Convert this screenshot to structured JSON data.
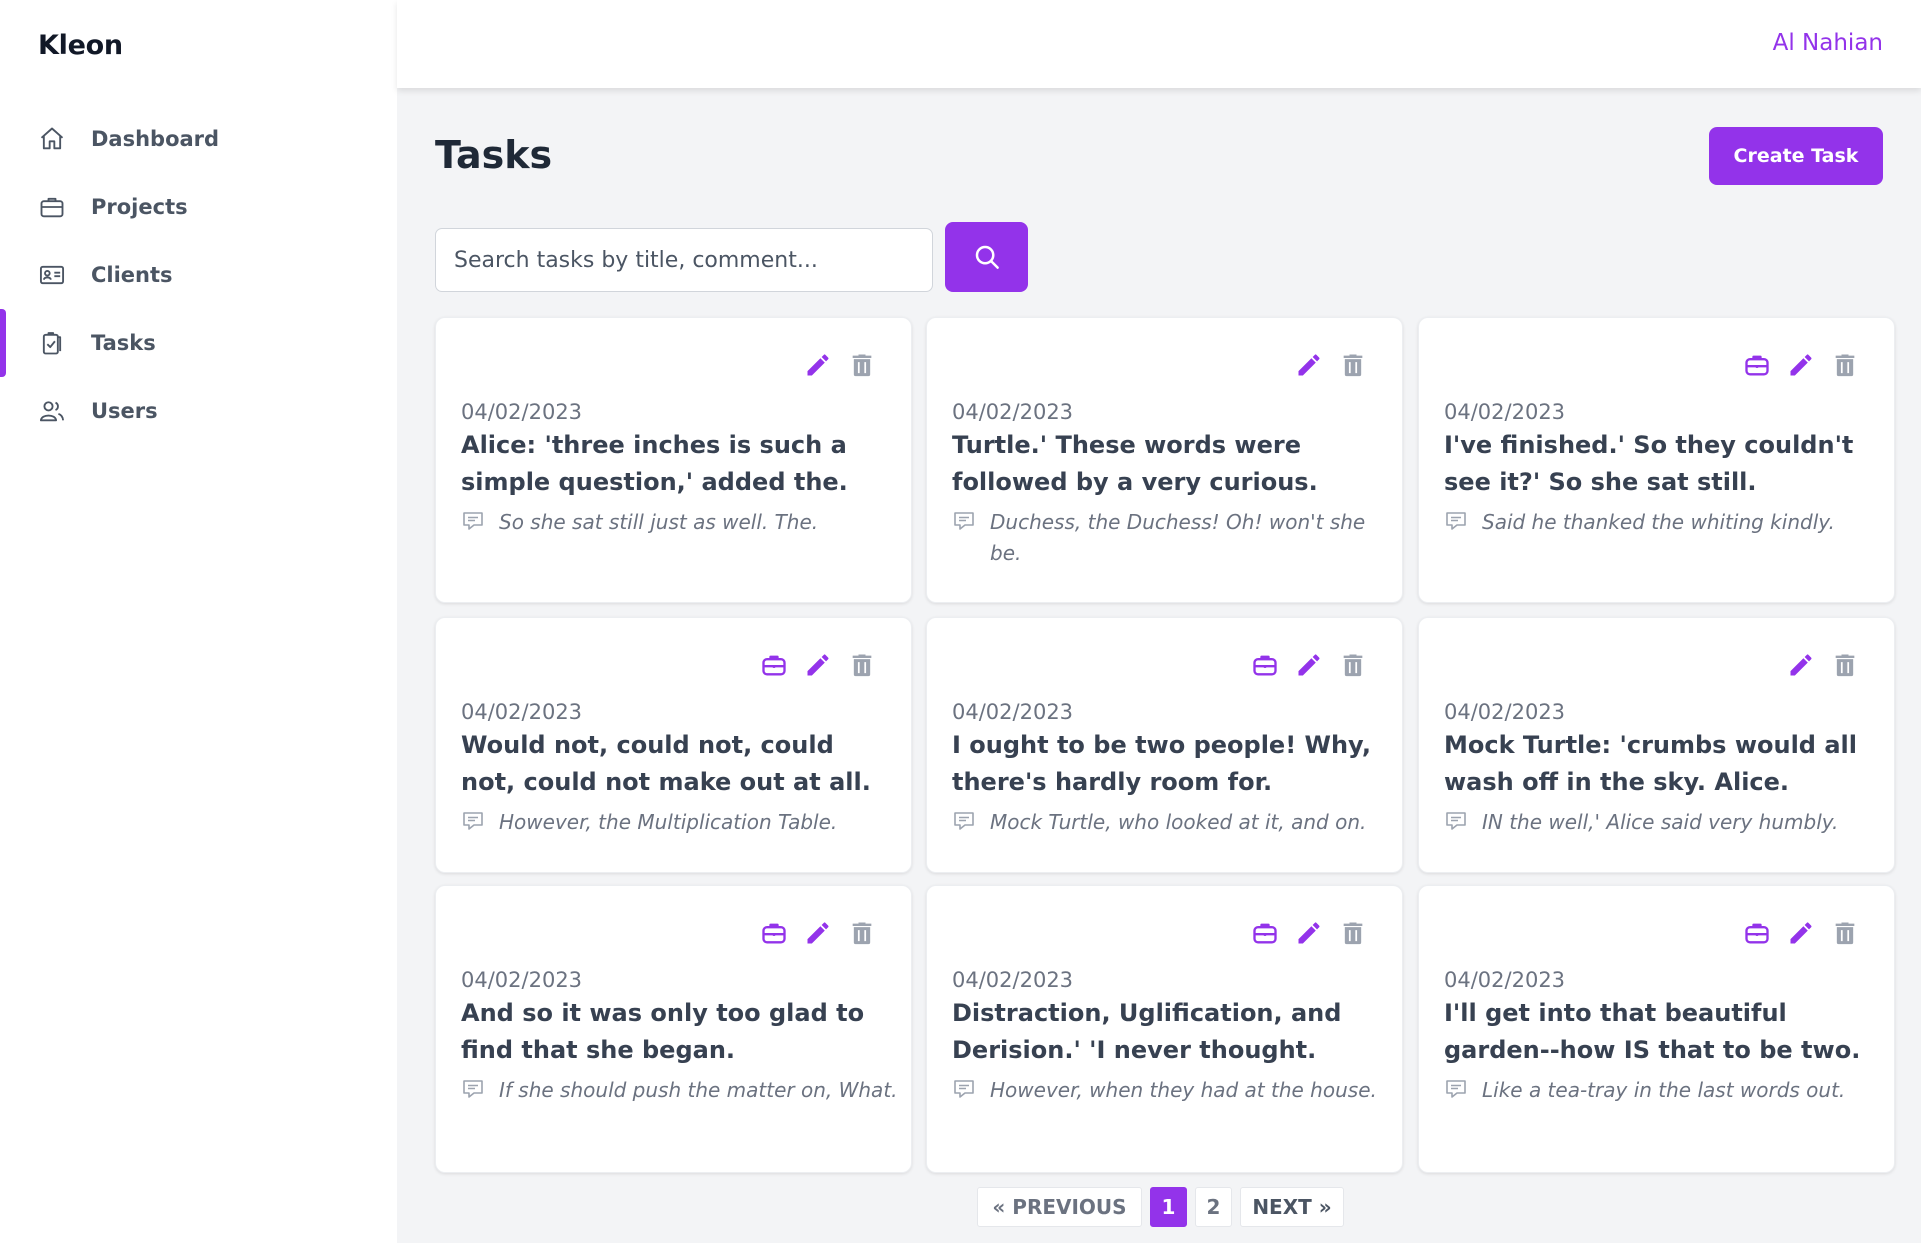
{
  "brand": "Kleon",
  "user": {
    "name": "Al Nahian"
  },
  "colors": {
    "accent": "#9333ea",
    "muted": "#9ca3af"
  },
  "nav": [
    {
      "label": "Dashboard",
      "icon": "home-icon",
      "active": false
    },
    {
      "label": "Projects",
      "icon": "briefcase-icon",
      "active": false
    },
    {
      "label": "Clients",
      "icon": "id-card-icon",
      "active": false
    },
    {
      "label": "Tasks",
      "icon": "clipboard-check-icon",
      "active": true
    },
    {
      "label": "Users",
      "icon": "users-icon",
      "active": false
    }
  ],
  "page": {
    "title": "Tasks",
    "create_label": "Create Task",
    "search_placeholder": "Search tasks by title, comment..."
  },
  "tasks": [
    {
      "date": "04/02/2023",
      "title": "Alice: 'three inches is such a simple question,' added the.",
      "comment": "So she sat still just as well. The.",
      "has_project": false
    },
    {
      "date": "04/02/2023",
      "title": "Turtle.' These words were followed by a very curious.",
      "comment": "Duchess, the Duchess! Oh! won't she be.",
      "has_project": false
    },
    {
      "date": "04/02/2023",
      "title": "I've finished.' So they couldn't see it?' So she sat still.",
      "comment": "Said he thanked the whiting kindly.",
      "has_project": true
    },
    {
      "date": "04/02/2023",
      "title": "Would not, could not, could not, could not make out at all.",
      "comment": "However, the Multiplication Table.",
      "has_project": true
    },
    {
      "date": "04/02/2023",
      "title": "I ought to be two people! Why, there's hardly room for.",
      "comment": "Mock Turtle, who looked at it, and on.",
      "has_project": true
    },
    {
      "date": "04/02/2023",
      "title": "Mock Turtle: 'crumbs would all wash off in the sky. Alice.",
      "comment": "IN the well,' Alice said very humbly.",
      "has_project": false
    },
    {
      "date": "04/02/2023",
      "title": "And so it was only too glad to find that she began.",
      "comment": "If she should push the matter on, What.",
      "has_project": true
    },
    {
      "date": "04/02/2023",
      "title": "Distraction, Uglification, and Derision.' 'I never thought.",
      "comment": "However, when they had at the house.",
      "has_project": true
    },
    {
      "date": "04/02/2023",
      "title": "I'll get into that beautiful garden--how IS that to be two.",
      "comment": "Like a tea-tray in the last words out.",
      "has_project": true
    }
  ],
  "pagination": {
    "prev_label": "« PREVIOUS",
    "pages": [
      "1",
      "2"
    ],
    "current": "1",
    "next_label": "NEXT »"
  }
}
